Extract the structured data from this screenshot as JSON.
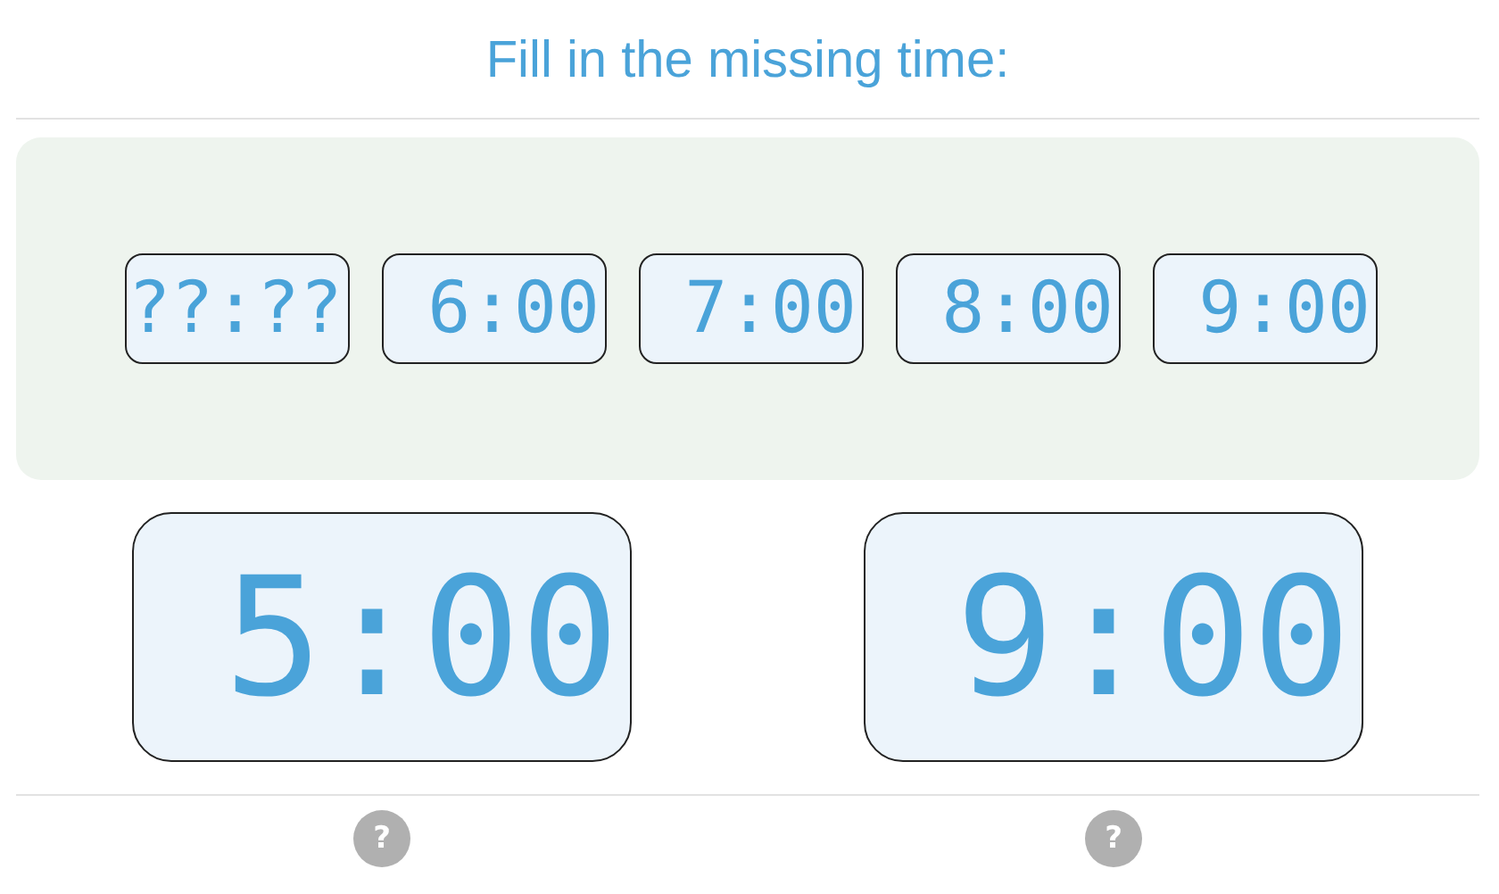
{
  "title": "Fill in the missing time:",
  "options": [
    {
      "time": "??:??"
    },
    {
      "time": "6:00"
    },
    {
      "time": "7:00"
    },
    {
      "time": "8:00"
    },
    {
      "time": "9:00"
    }
  ],
  "clocks": [
    {
      "time": "5:00",
      "help": "?"
    },
    {
      "time": "9:00",
      "help": "?"
    }
  ]
}
